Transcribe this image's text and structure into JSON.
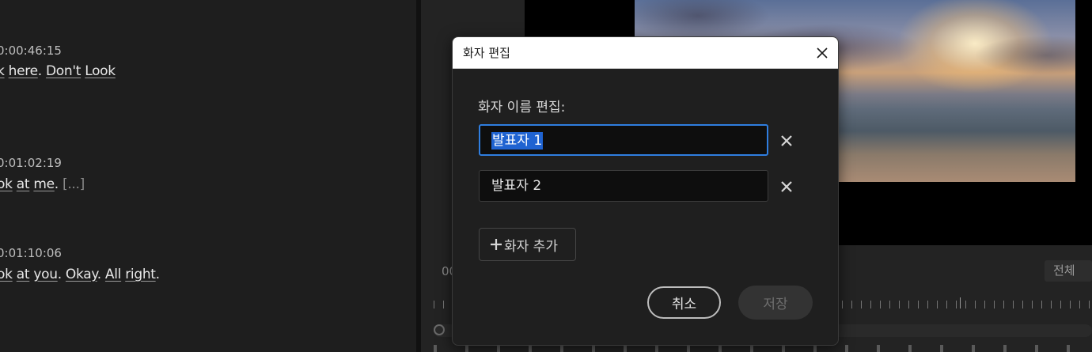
{
  "transcript": {
    "entries": [
      {
        "timecode": "0:00:46:15",
        "words": [
          "k",
          "here",
          "Don't",
          "Look"
        ],
        "text_parts": [
          "k",
          " ",
          "here",
          ". ",
          "Don't",
          " ",
          "Look"
        ]
      },
      {
        "timecode": "0:01:02:19",
        "words": [
          "ok",
          "at",
          "me"
        ],
        "ellipsis": "[...]"
      },
      {
        "timecode": "0:01:10:06",
        "words": [
          "ok",
          "at",
          "you",
          "Okay",
          "All",
          "right"
        ]
      }
    ]
  },
  "monitor": {
    "timecode_partial": "00",
    "fit_option": "전체"
  },
  "dialog": {
    "title": "화자 편집",
    "section_label": "화자 이름 편집:",
    "speakers": [
      {
        "name": "발표자 1",
        "selected": true
      },
      {
        "name": "발표자 2",
        "selected": false
      }
    ],
    "add_speaker_label": "화자 추가",
    "cancel_label": "취소",
    "save_label": "저장",
    "save_enabled": false,
    "accent_color": "#2f7ee0",
    "selection_color": "#1f63d1"
  }
}
